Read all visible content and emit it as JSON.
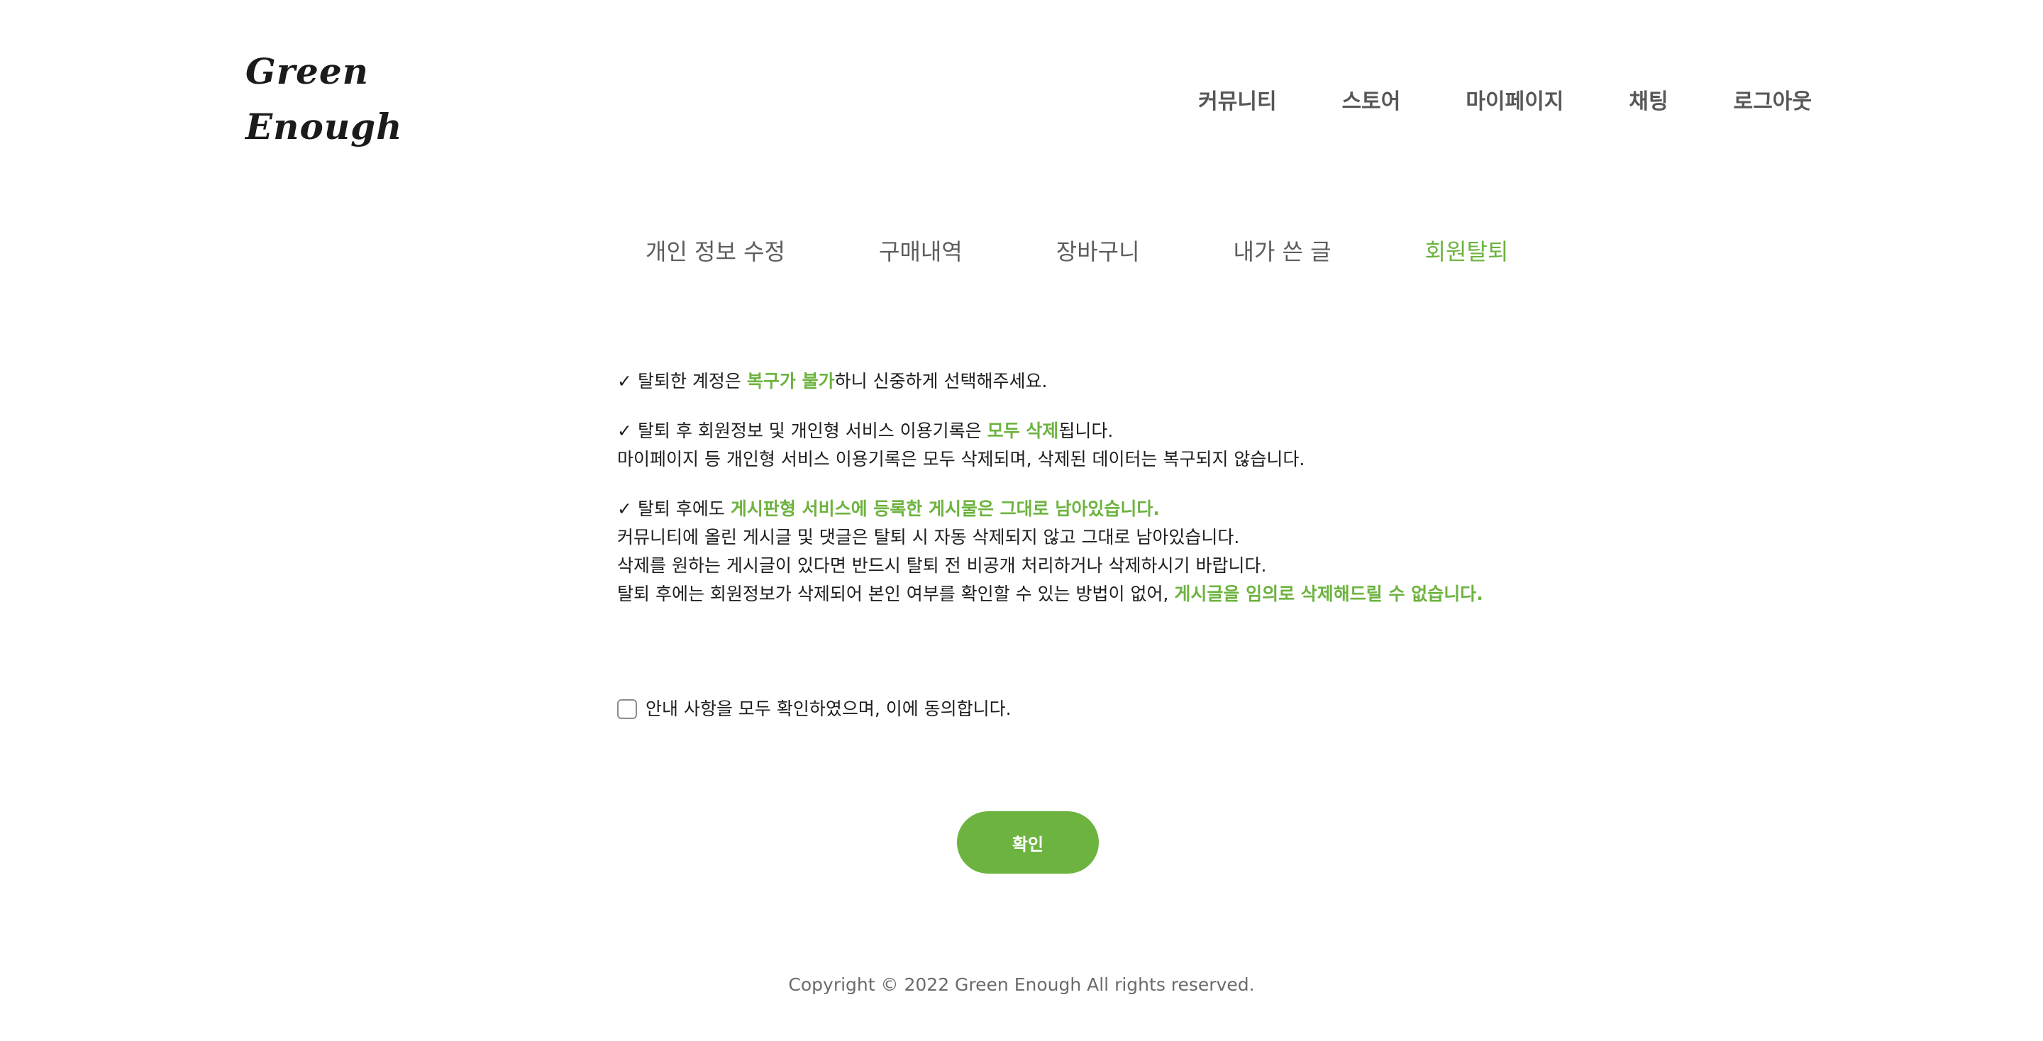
{
  "header": {
    "logo_line1": "Green",
    "logo_line2": "Enough",
    "nav": [
      "커뮤니티",
      "스토어",
      "마이페이지",
      "채팅",
      "로그아웃"
    ]
  },
  "tabs": [
    "개인 정보 수정",
    "구매내역",
    "장바구니",
    "내가 쓴 글",
    "회원탈퇴"
  ],
  "active_tab": "회원탈퇴",
  "notice": {
    "item1": {
      "check": "✓",
      "pre": "탈퇴한 계정은 ",
      "highlight": "복구가 불가",
      "post": "하니 신중하게 선택해주세요."
    },
    "item2": {
      "check": "✓",
      "pre": "탈퇴 후 회원정보 및 개인형 서비스 이용기록은 ",
      "highlight": "모두 삭제",
      "post": "됩니다.",
      "line2": "마이페이지 등 개인형 서비스 이용기록은 모두 삭제되며, 삭제된 데이터는 복구되지 않습니다."
    },
    "item3": {
      "check": "✓",
      "pre": "탈퇴 후에도 ",
      "highlight": "게시판형 서비스에 등록한 게시물은 그대로 남아있습니다.",
      "line2": "커뮤니티에 올린 게시글 및 댓글은 탈퇴 시 자동 삭제되지 않고 그대로 남아있습니다.",
      "line3": "삭제를 원하는 게시글이 있다면 반드시 탈퇴 전 비공개 처리하거나 삭제하시기 바랍니다.",
      "line4_pre": "탈퇴 후에는 회원정보가 삭제되어 본인 여부를 확인할 수 있는 방법이 없어, ",
      "line4_highlight": "게시글을 임의로 삭제해드릴 수 없습니다."
    }
  },
  "agree_label": "안내 사항을 모두 확인하였으며, 이에 동의합니다.",
  "agree_checked": false,
  "confirm_label": "확인",
  "footer": "Copyright © 2022 Green Enough All rights reserved.",
  "colors": {
    "accent": "#6db33f",
    "text": "#1e1e1e",
    "muted": "#5d5d5d"
  }
}
